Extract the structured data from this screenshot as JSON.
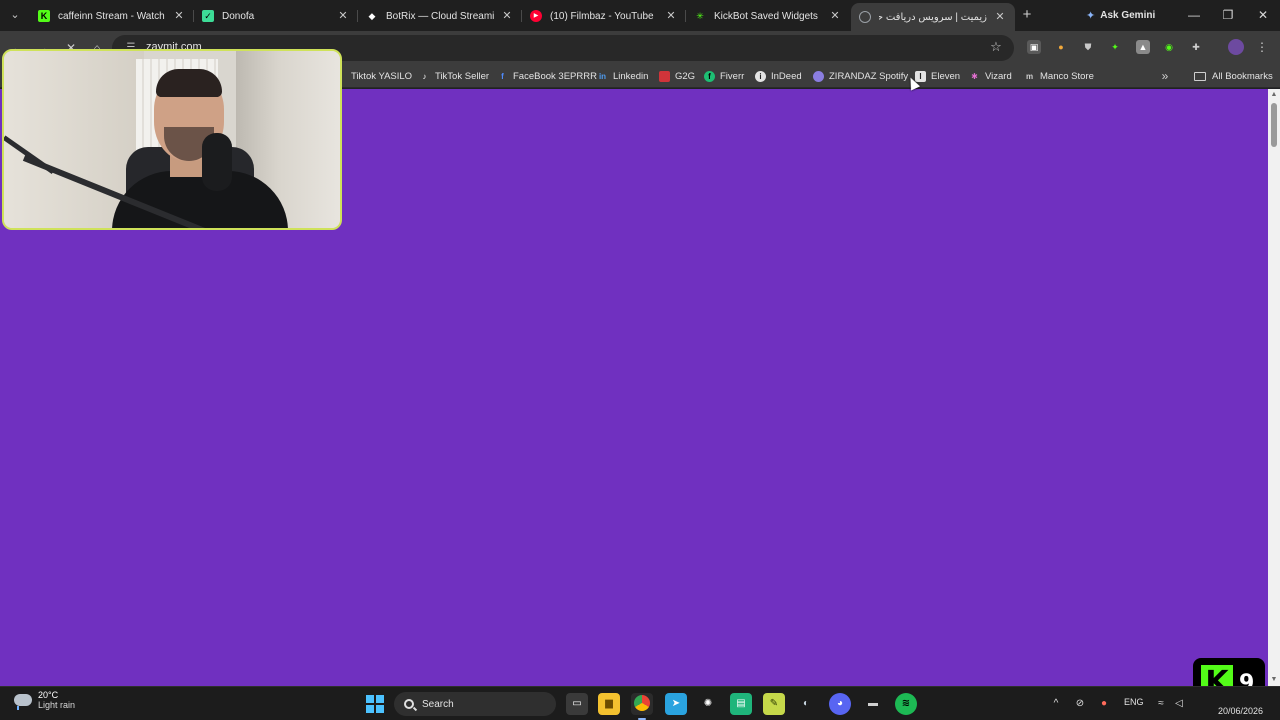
{
  "browser": {
    "tabs": [
      {
        "title": "caffeinn Stream - Watch Live",
        "favicon": "kick-icon",
        "color": "#53fc18"
      },
      {
        "title": "Donofa",
        "favicon": "donofa-icon",
        "color": "#3ddc97"
      },
      {
        "title": "BotRix — Cloud Streaming",
        "favicon": "botrix-icon",
        "color": "#ffffff"
      },
      {
        "title": "(10) Filmbaz - YouTube",
        "favicon": "youtube-icon",
        "color": "#ff0033"
      },
      {
        "title": "KickBot Saved Widgets",
        "favicon": "kickbot-icon",
        "color": "#53fc18"
      },
      {
        "title": "زیمیت | سرویس دریافت حمایت",
        "favicon": "globe-icon",
        "color": "#9aa0a6",
        "active": true
      }
    ],
    "new_tab_label": "+",
    "ask_gemini_label": "Ask Gemini",
    "url": "zaymit.com",
    "bookmarks": [
      {
        "label": "Tiktok YASILO",
        "icon": "tiktok-icon"
      },
      {
        "label": "TikTok Seller",
        "icon": "tiktok-icon"
      },
      {
        "label": "FaceBook 3EPRRR",
        "icon": "facebook-icon"
      },
      {
        "label": "Linkedin",
        "icon": "linkedin-icon"
      },
      {
        "label": "G2G",
        "icon": "g2g-icon"
      },
      {
        "label": "Fiverr",
        "icon": "fiverr-icon"
      },
      {
        "label": "InDeed",
        "icon": "indeed-icon"
      },
      {
        "label": "ZIRANDAZ Spotify",
        "icon": "spotify-icon"
      },
      {
        "label": "Eleven",
        "icon": "eleven-icon"
      },
      {
        "label": "Vizard",
        "icon": "vizard-icon"
      },
      {
        "label": "Manco Store",
        "icon": "store-icon"
      }
    ],
    "all_bookmarks_label": "All Bookmarks",
    "page_background": "#7030c0"
  },
  "stream_overlay": {
    "kick_letter": "K",
    "kick_number": "9",
    "kick_color": "#53fc18"
  },
  "taskbar": {
    "weather_temp": "20°C",
    "weather_desc": "Light rain",
    "search_label": "Search",
    "language": "ENG",
    "date": "20/06/2026",
    "apps": [
      "file-explorer-icon",
      "task-view-icon",
      "folder-icon",
      "chrome-icon",
      "telegram-icon",
      "chatgpt-icon",
      "app-green-icon",
      "notes-icon",
      "steam-icon",
      "discord-icon",
      "terminal-icon",
      "spotify-icon"
    ]
  }
}
